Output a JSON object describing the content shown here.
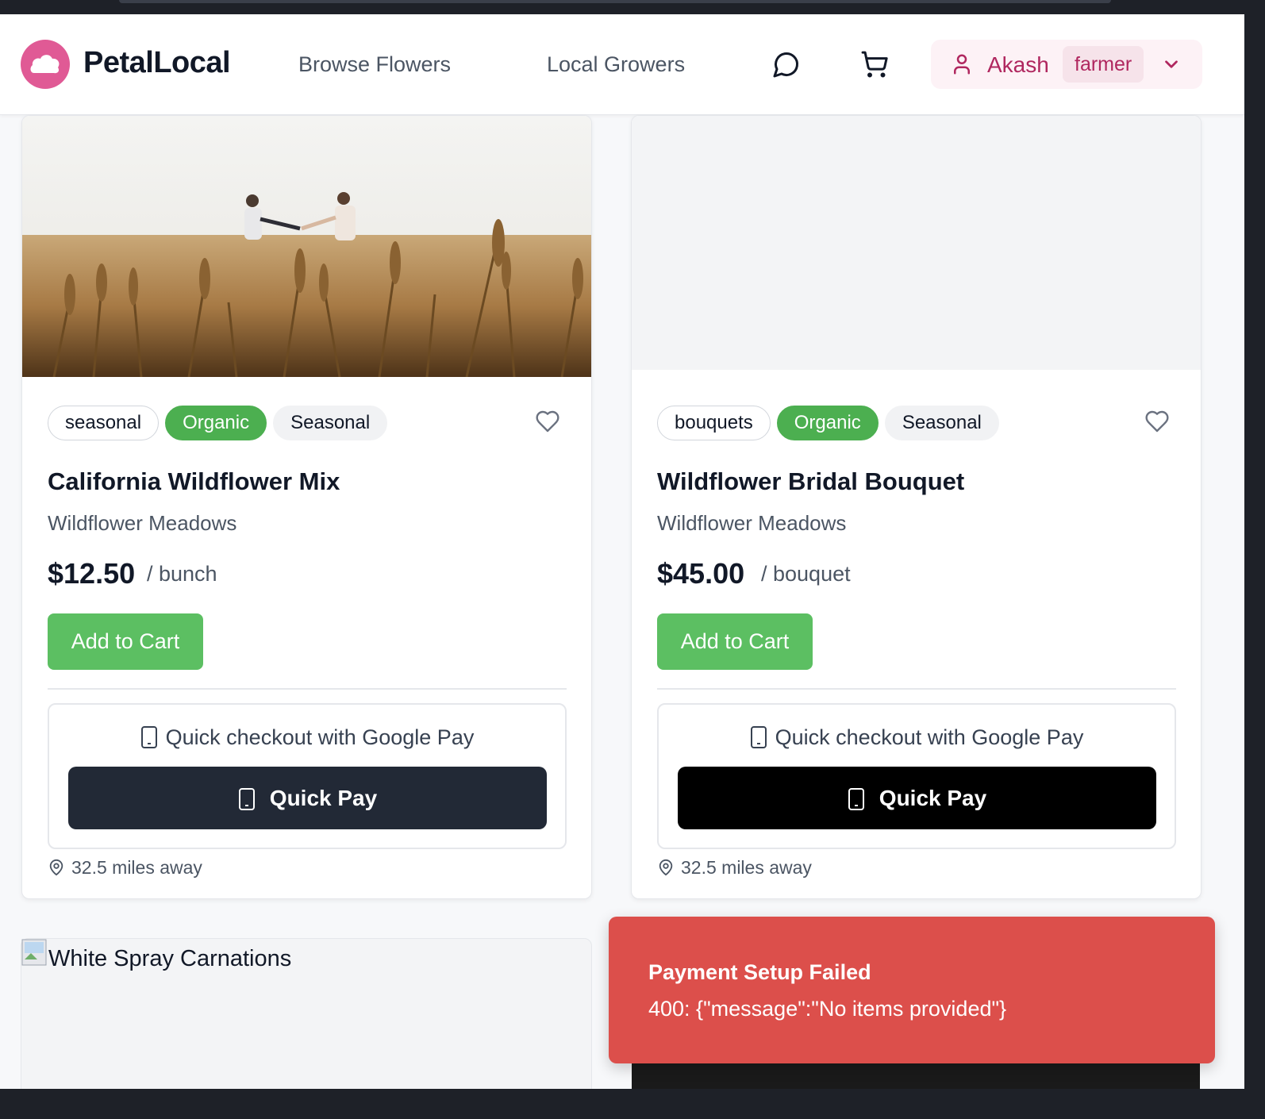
{
  "header": {
    "brand": "PetalLocal",
    "nav": [
      "Browse Flowers",
      "Local Growers"
    ],
    "icons": [
      "chat-icon",
      "cart-icon"
    ],
    "user": {
      "name": "Akash",
      "role": "farmer"
    }
  },
  "products": [
    {
      "tags": [
        "seasonal",
        "Organic",
        "Seasonal"
      ],
      "title": "California Wildflower Mix",
      "grower": "Wildflower Meadows",
      "price": "$12.50",
      "unit": "/ bunch",
      "add_label": "Add to Cart",
      "quick_checkout_label": "Quick checkout with Google Pay",
      "quick_pay_label": "Quick Pay",
      "distance": "32.5 miles away",
      "image": "wheat-field-photo"
    },
    {
      "tags": [
        "bouquets",
        "Organic",
        "Seasonal"
      ],
      "title": "Wildflower Bridal Bouquet",
      "grower": "Wildflower Meadows",
      "price": "$45.00",
      "unit": "/ bouquet",
      "add_label": "Add to Cart",
      "quick_checkout_label": "Quick checkout with Google Pay",
      "quick_pay_label": "Quick Pay",
      "distance": "32.5 miles away",
      "image": "blank-placeholder"
    }
  ],
  "broken_product": {
    "alt": "White Spray Carnations"
  },
  "toast": {
    "title": "Payment Setup Failed",
    "message": "400: {\"message\":\"No items provided\"}"
  },
  "colors": {
    "brand_pink": "#e05a95",
    "organic_green": "#4caf50",
    "add_green": "#5cbf62",
    "quick_pay_dark_1": "#222936",
    "quick_pay_dark_2": "#000000",
    "toast_red": "#dc4f4b"
  }
}
